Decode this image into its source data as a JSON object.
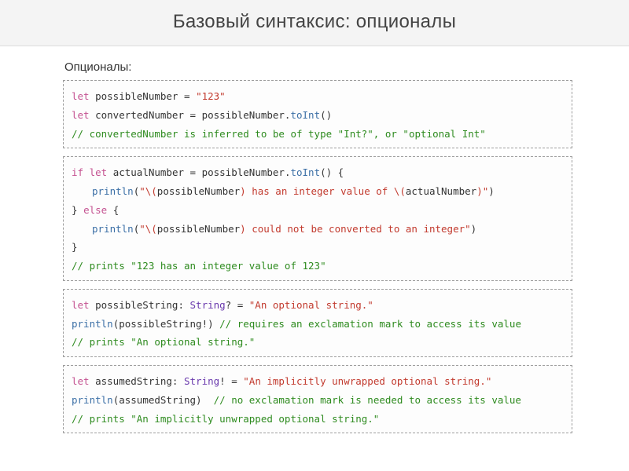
{
  "title": "Базовый синтаксис: опционалы",
  "subtitle": "Опционалы:",
  "box1": {
    "l1_let": "let",
    "l1_var": " possibleNumber ",
    "l1_eq": "= ",
    "l1_str": "\"123\"",
    "l2_let": "let",
    "l2_var": " convertedNumber ",
    "l2_eq": "= ",
    "l2_rhs1": "possibleNumber.",
    "l2_fn": "toInt",
    "l2_rhs2": "()",
    "l3_cmt": "// convertedNumber is inferred to be of type \"Int?\", or \"optional Int\""
  },
  "box2": {
    "l1_if": "if",
    "l1_sp": " ",
    "l1_let": "let",
    "l1_mid": " actualNumber = possibleNumber.",
    "l1_fn": "toInt",
    "l1_tail": "() {",
    "l2_fn": "println",
    "l2_a": "(",
    "l2_s1": "\"\\(",
    "l2_v1": "possibleNumber",
    "l2_s2": ") has an integer value of \\(",
    "l2_v2": "actualNumber",
    "l2_s3": ")\"",
    "l2_b": ")",
    "l3_close": "} ",
    "l3_else": "else",
    "l3_open": " {",
    "l4_fn": "println",
    "l4_a": "(",
    "l4_s1": "\"\\(",
    "l4_v1": "possibleNumber",
    "l4_s2": ") could not be converted to an integer\"",
    "l4_b": ")",
    "l5_close": "}",
    "l6_cmt": "// prints \"123 has an integer value of 123\""
  },
  "box3": {
    "l1_let": "let",
    "l1_var": " possibleString: ",
    "l1_type": "String",
    "l1_q": "? = ",
    "l1_str": "\"An optional string.\"",
    "l2_fn": "println",
    "l2_a": "(possibleString!) ",
    "l2_cmt": "// requires an exclamation mark to access its value",
    "l3_cmt": "// prints \"An optional string.\""
  },
  "box4": {
    "l1_let": "let",
    "l1_var": " assumedString: ",
    "l1_type": "String",
    "l1_q": "! = ",
    "l1_str": "\"An implicitly unwrapped optional string.\"",
    "l2_fn": "println",
    "l2_a": "(assumedString)  ",
    "l2_cmt": "// no exclamation mark is needed to access its value",
    "l3_cmt": "// prints \"An implicitly unwrapped optional string.\""
  }
}
